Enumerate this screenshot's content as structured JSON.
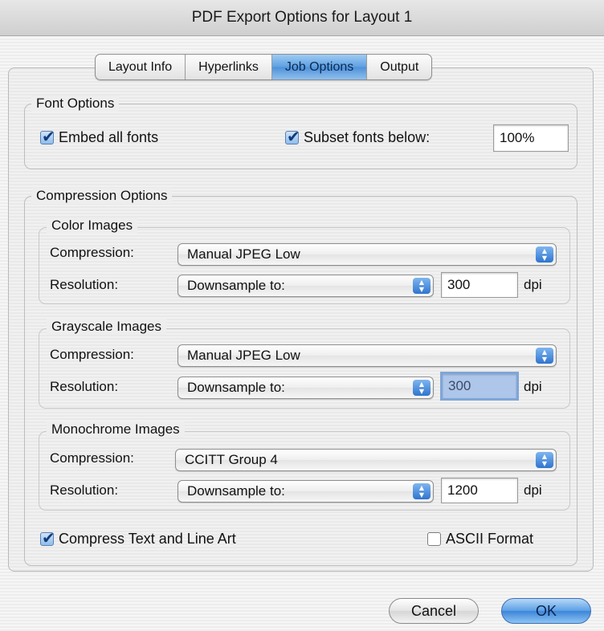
{
  "window": {
    "title": "PDF Export Options for Layout 1"
  },
  "tabs": [
    {
      "label": "Layout Info"
    },
    {
      "label": "Hyperlinks"
    },
    {
      "label": "Job Options",
      "active": true
    },
    {
      "label": "Output"
    }
  ],
  "font_options": {
    "title": "Font Options",
    "embed_all_fonts": {
      "label": "Embed all fonts",
      "checked": true
    },
    "subset_fonts_below": {
      "label": "Subset fonts below:",
      "checked": true,
      "value": "100%"
    }
  },
  "compression_options": {
    "title": "Compression Options",
    "color_images": {
      "title": "Color Images",
      "compression_label": "Compression:",
      "compression_value": "Manual JPEG Low",
      "resolution_label": "Resolution:",
      "resolution_value": "Downsample to:",
      "dpi_value": "300",
      "dpi_unit": "dpi"
    },
    "grayscale_images": {
      "title": "Grayscale Images",
      "compression_label": "Compression:",
      "compression_value": "Manual JPEG Low",
      "resolution_label": "Resolution:",
      "resolution_value": "Downsample to:",
      "dpi_value": "300",
      "dpi_unit": "dpi"
    },
    "monochrome_images": {
      "title": "Monochrome Images",
      "compression_label": "Compression:",
      "compression_value": "CCITT Group 4",
      "resolution_label": "Resolution:",
      "resolution_value": "Downsample to:",
      "dpi_value": "1200",
      "dpi_unit": "dpi"
    },
    "compress_text": {
      "label": "Compress Text and Line Art",
      "checked": true
    },
    "ascii_format": {
      "label": "ASCII Format",
      "checked": false
    }
  },
  "buttons": {
    "cancel": "Cancel",
    "ok": "OK"
  },
  "icons": {
    "checkbox": "checkmark-icon",
    "popup": "up-down-arrows-icon"
  },
  "colors": {
    "accent": "#4f91d9",
    "focus": "#aec6ea"
  }
}
